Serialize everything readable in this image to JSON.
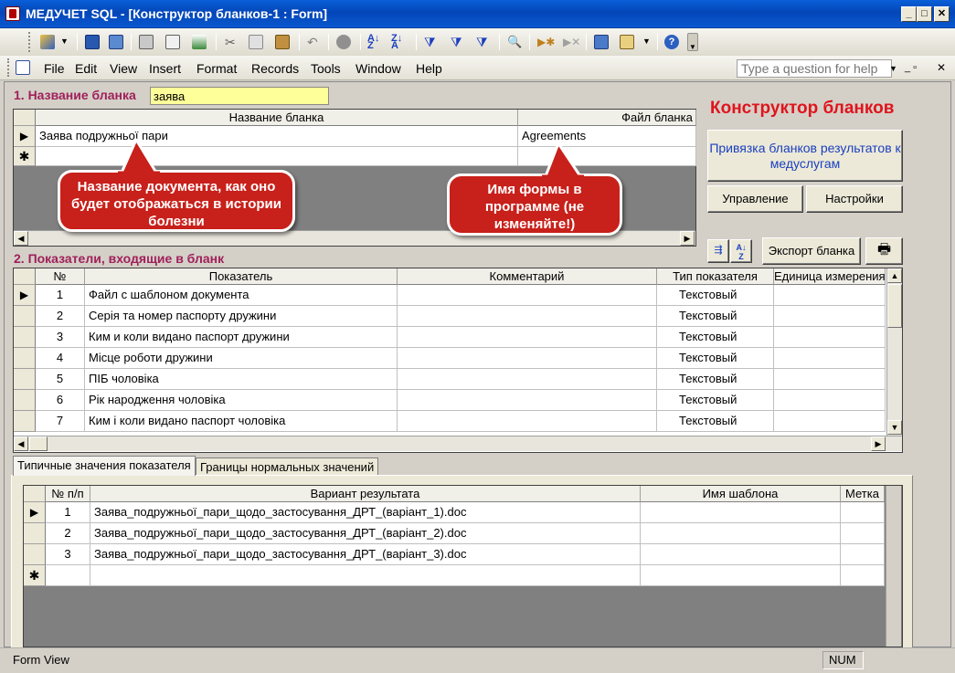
{
  "window": {
    "title": "МЕДУЧЕТ SQL - [Конструктор бланков-1 : Form]",
    "min_glyph": "_",
    "max_glyph": "□",
    "close_glyph": "✕"
  },
  "menu": {
    "items": [
      "File",
      "Edit",
      "View",
      "Insert",
      "Format",
      "Records",
      "Tools",
      "Window",
      "Help"
    ],
    "help_placeholder": "Type a question for help"
  },
  "section1": {
    "label": "1. Название бланка",
    "name_value": "заява",
    "columns": [
      "Название бланка",
      "Файл бланка"
    ],
    "row": {
      "name": "Заява подружньої пари",
      "file": "Agreements"
    },
    "new_row_marker": "✱"
  },
  "callouts": {
    "doc_name": "Название документа, как оно будет отображаться в истории болезни",
    "form_name": "Имя формы в программе (не изменяйте!)"
  },
  "right_panel": {
    "title": "Конструктор бланков",
    "bind_button": "Привязка бланков результатов к медуслугам",
    "manage_button": "Управление",
    "settings_button": "Настройки",
    "export_button": "Экспорт бланка"
  },
  "section2": {
    "label": "2. Показатели, входящие в бланк",
    "columns": [
      "№",
      "Показатель",
      "Комментарий",
      "Тип показателя",
      "Единица измерения"
    ],
    "rows": [
      {
        "n": "1",
        "name": "Файл с шаблоном документа",
        "comment": "",
        "type": "Текстовый",
        "unit": ""
      },
      {
        "n": "2",
        "name": "Серія та номер паспорту дружини",
        "comment": "",
        "type": "Текстовый",
        "unit": ""
      },
      {
        "n": "3",
        "name": "Ким и коли видано паспорт дружини",
        "comment": "",
        "type": "Текстовый",
        "unit": ""
      },
      {
        "n": "4",
        "name": "Місце роботи дружини",
        "comment": "",
        "type": "Текстовый",
        "unit": ""
      },
      {
        "n": "5",
        "name": "ПІБ чоловіка",
        "comment": "",
        "type": "Текстовый",
        "unit": ""
      },
      {
        "n": "6",
        "name": "Рік народження чоловіка",
        "comment": "",
        "type": "Текстовый",
        "unit": ""
      },
      {
        "n": "7",
        "name": "Ким і коли видано паспорт чоловіка",
        "comment": "",
        "type": "Текстовый",
        "unit": ""
      }
    ]
  },
  "tabs": [
    "Типичные значения показателя",
    "Границы нормальных значений"
  ],
  "section3": {
    "columns": [
      "№ п/п",
      "Вариант результата",
      "Имя шаблона",
      "Метка"
    ],
    "rows": [
      {
        "n": "1",
        "variant": "Заява_подружньої_пари_щодо_застосування_ДРТ_(варіант_1).doc",
        "template": "",
        "mark": ""
      },
      {
        "n": "2",
        "variant": "Заява_подружньої_пари_щодо_застосування_ДРТ_(варіант_2).doc",
        "template": "",
        "mark": ""
      },
      {
        "n": "3",
        "variant": "Заява_подружньої_пари_щодо_застосування_ДРТ_(варіант_3).doc",
        "template": "",
        "mark": ""
      }
    ],
    "new_row_marker": "✱"
  },
  "status": {
    "left": "Form View",
    "num": "NUM"
  },
  "colors": {
    "accent_red": "#e0141c",
    "highlight_yellow": "#ffff99",
    "section_label": "#a0205a",
    "link_blue": "#1a3fbf"
  }
}
